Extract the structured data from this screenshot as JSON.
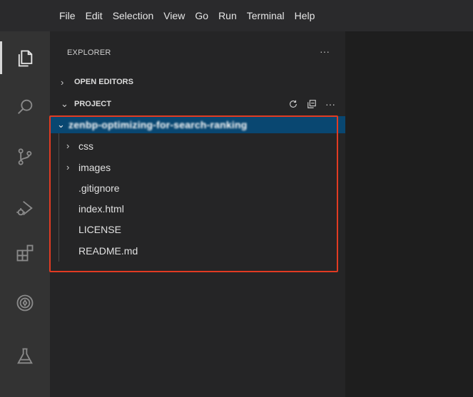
{
  "menubar": {
    "items": [
      "File",
      "Edit",
      "Selection",
      "View",
      "Go",
      "Run",
      "Terminal",
      "Help"
    ]
  },
  "activity_bar": {
    "icons": [
      "files-icon",
      "search-icon",
      "source-control-icon",
      "run-debug-icon",
      "extensions-icon",
      "remote-icon",
      "testing-icon"
    ]
  },
  "sidebar": {
    "title": "EXPLORER",
    "more": "···",
    "open_editors": {
      "chevron": "›",
      "label": "OPEN EDITORS"
    },
    "project": {
      "chevron": "⌄",
      "label": "PROJECT",
      "more": "···"
    },
    "root": {
      "chevron": "⌄",
      "name": "zenbp-optimizing-for-search-ranking"
    },
    "items": [
      {
        "chevron": "›",
        "name": "css"
      },
      {
        "chevron": "›",
        "name": "images"
      },
      {
        "chevron": "",
        "name": ".gitignore"
      },
      {
        "chevron": "",
        "name": "index.html"
      },
      {
        "chevron": "",
        "name": "LICENSE"
      },
      {
        "chevron": "",
        "name": "README.md"
      }
    ]
  },
  "colors": {
    "accent_selection": "#094771",
    "highlight_border": "#e23b22"
  }
}
